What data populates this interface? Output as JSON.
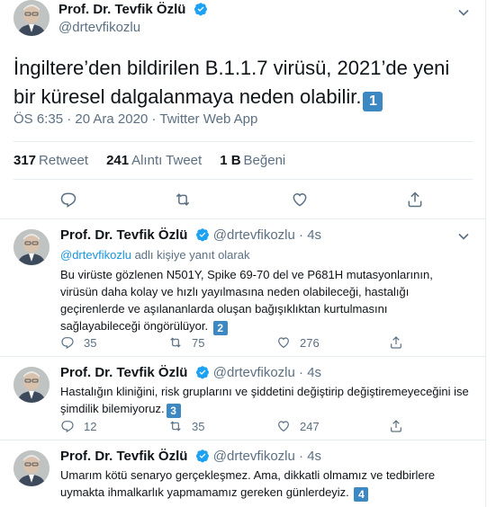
{
  "author": {
    "name": "Prof. Dr. Tevfik Özlü",
    "handle": "@drtevfikozlu"
  },
  "main_tweet": {
    "text": "İngiltere’den bildirilen B.1.1.7 virüsü, 2021’de yeni bir küresel dalgalanmaya neden olabilir.",
    "thread_marker": "1",
    "time": "ÖS 6:35",
    "date": "20 Ara 2020",
    "separator": "·",
    "source": "Twitter Web App",
    "stats": {
      "retweets_count": "317",
      "retweets_label": "Retweet",
      "quotes_count": "241",
      "quotes_label": "Alıntı Tweet",
      "likes_count": "1 B",
      "likes_label": "Beğeni"
    }
  },
  "replies": [
    {
      "name": "Prof. Dr. Tevfik Özlü",
      "handle": "@drtevfikozlu",
      "dot": "·",
      "age": "4s",
      "replying_to_handle": "@drtevfikozlu",
      "replying_to_suffix": "adlı kişiye yanıt olarak",
      "text": "Bu virüste gözlenen N501Y, Spike 69-70 del ve P681H mutasyonlarının, virüsün daha kolay ve hızlı yayılmasına neden olabileceği, hastalığı geçirenlerde ve aşılananlarda oluşan bağışıklıktan kurtulmasını sağlayabileceği öngörülüyor.",
      "thread_marker": "2",
      "reply_count": "35",
      "retweet_count": "75",
      "like_count": "276"
    },
    {
      "name": "Prof. Dr. Tevfik Özlü",
      "handle": "@drtevfikozlu",
      "dot": "·",
      "age": "4s",
      "text": "Hastalığın kliniğini, risk gruplarını ve şiddetini değiştirip değiştiremeyeceğini ise şimdilik bilemiyoruz.",
      "thread_marker": "3",
      "reply_count": "12",
      "retweet_count": "35",
      "like_count": "247"
    },
    {
      "name": "Prof. Dr. Tevfik Özlü",
      "handle": "@drtevfikozlu",
      "dot": "·",
      "age": "4s",
      "text": "Umarım kötü senaryo gerçekleşmez. Ama, dikkatli olmamız ve tedbirlere uymakta ihmalkarlık yapmamamız gereken günlerdeyiz.",
      "thread_marker": "4"
    }
  ],
  "colors": {
    "verified_blue": "#1da1f2",
    "link_blue": "#1b95e0",
    "muted_gray": "#5b7083",
    "divider": "#e6ecf0",
    "keycap_blue": "#3b88c3"
  },
  "icons": [
    "verified-badge-icon",
    "chevron-down-icon",
    "reply-icon",
    "retweet-icon",
    "like-icon",
    "share-icon"
  ]
}
